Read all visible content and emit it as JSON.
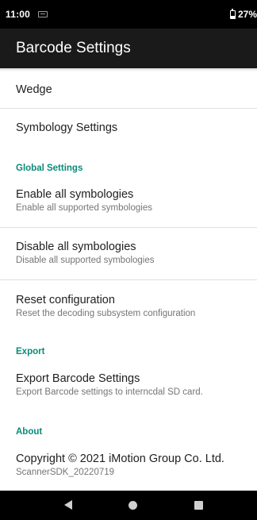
{
  "status_bar": {
    "time": "11:00",
    "battery": "27%"
  },
  "app_bar": {
    "title": "Barcode Settings"
  },
  "items": {
    "wedge": {
      "title": "Wedge"
    },
    "symbology_settings": {
      "title": "Symbology Settings"
    },
    "enable_all": {
      "title": "Enable all symbologies",
      "summary": "Enable all supported symbologies"
    },
    "disable_all": {
      "title": "Disable all symbologies",
      "summary": "Disable all supported symbologies"
    },
    "reset": {
      "title": "Reset configuration",
      "summary": "Reset the decoding subsystem configuration"
    },
    "export_settings": {
      "title": "Export Barcode Settings",
      "summary": "Export Barcode settings to interncdal SD card."
    },
    "copyright": {
      "title": "Copyright © 2021 iMotion Group Co. Ltd.",
      "summary": "ScannerSDK_20220719"
    }
  },
  "sections": {
    "global": "Global Settings",
    "export": "Export",
    "about": "About"
  },
  "icons": {
    "status_notification": "notification-icon",
    "battery": "battery-icon",
    "nav_back": "back-icon",
    "nav_home": "home-icon",
    "nav_recents": "recents-icon"
  },
  "colors": {
    "section_header": "#0a8a7a",
    "app_bar": "#1a1a1a"
  }
}
